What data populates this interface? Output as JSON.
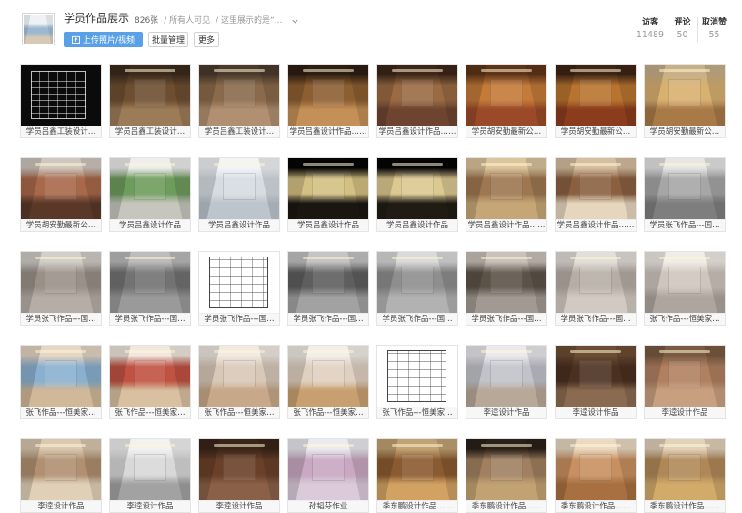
{
  "album": {
    "title": "学员作品展示",
    "count": "826张",
    "visibility": "/ 所有人可见",
    "description": "/ 这里展示的是“…",
    "cover_tones": [
      "#eef2f5",
      "#9cb8d0",
      "#d6cab6"
    ]
  },
  "toolbar": {
    "upload_label": "上传照片/视频",
    "upload_icon": "upload-icon",
    "batch_label": "批量管理",
    "more_label": "更多",
    "expand_icon": "chevron-down-icon"
  },
  "stats": [
    {
      "label": "访客",
      "value": "11489"
    },
    {
      "label": "评论",
      "value": "50"
    },
    {
      "label": "取消赞",
      "value": "55"
    }
  ],
  "colors": {
    "accent": "#5aa0e6",
    "text": "#333333",
    "muted": "#999999"
  },
  "photos": [
    {
      "caption": "学员吕鑫工装设计…",
      "tones": [
        "#0b0b0b",
        "#111111",
        "#0b0b0b"
      ]
    },
    {
      "caption": "学员吕鑫工装设计…",
      "tones": [
        "#3b2a1c",
        "#6e4e30",
        "#9c7b58"
      ]
    },
    {
      "caption": "学员吕鑫工装设计…",
      "tones": [
        "#4a3a2c",
        "#8a6a4a",
        "#b09070"
      ]
    },
    {
      "caption": "学员吕鑫设计作品……",
      "tones": [
        "#2e1e12",
        "#8c5e30",
        "#c49058"
      ]
    },
    {
      "caption": "学员吕鑫设计作品……",
      "tones": [
        "#3c2618",
        "#9a6a42",
        "#6e4430"
      ]
    },
    {
      "caption": "学员胡安勤最新公…",
      "tones": [
        "#5e3418",
        "#c47a38",
        "#9a4a28"
      ]
    },
    {
      "caption": "学员胡安勤最新公…",
      "tones": [
        "#3e2414",
        "#b8742e",
        "#8a3c1c"
      ]
    },
    {
      "caption": "学员胡安勤最新公…",
      "tones": [
        "#c8b088",
        "#d8b070",
        "#a87a48"
      ]
    },
    {
      "caption": "学员胡安勤最新公…",
      "tones": [
        "#cfc6be",
        "#a8684a",
        "#5a3828"
      ]
    },
    {
      "caption": "学员吕鑫设计作品",
      "tones": [
        "#eeeeee",
        "#6e9c5c",
        "#c6c6be"
      ]
    },
    {
      "caption": "学员吕鑫设计作品",
      "tones": [
        "#f2f4f6",
        "#d6dce2",
        "#bcc4cc"
      ]
    },
    {
      "caption": "学员吕鑫设计作品",
      "tones": [
        "#050505",
        "#d4c083",
        "#1a1610"
      ]
    },
    {
      "caption": "学员吕鑫设计作品",
      "tones": [
        "#050505",
        "#dcc891",
        "#201c14"
      ]
    },
    {
      "caption": "学员吕鑫设计作品……",
      "tones": [
        "#dcc49c",
        "#9e7650",
        "#c6a676"
      ]
    },
    {
      "caption": "学员吕鑫设计作品……",
      "tones": [
        "#d6bea0",
        "#8a6040",
        "#e6d6be"
      ]
    },
    {
      "caption": "学员张飞作品---国…",
      "tones": [
        "#e6e6e6",
        "#a6a6a6",
        "#7e7e7e"
      ]
    },
    {
      "caption": "学员张飞作品---国…",
      "tones": [
        "#d2cec8",
        "#9a9088",
        "#b6aea6"
      ]
    },
    {
      "caption": "学员张飞作品---国…",
      "tones": [
        "#bcbcbc",
        "#727272",
        "#9a9a9a"
      ]
    },
    {
      "caption": "学员张飞作品---国…",
      "tones": [
        "#ffffff",
        "#ffffff",
        "#ffffff"
      ]
    },
    {
      "caption": "学员张飞作品---国…",
      "tones": [
        "#c4c4c4",
        "#5e5e5e",
        "#a2a2a2"
      ]
    },
    {
      "caption": "学员张飞作品---国…",
      "tones": [
        "#dadada",
        "#8e8e8e",
        "#b2b2b2"
      ]
    },
    {
      "caption": "学员张飞作品---国…",
      "tones": [
        "#cac2ba",
        "#5c5248",
        "#a29a92"
      ]
    },
    {
      "caption": "学员张飞作品---国…",
      "tones": [
        "#e2ded8",
        "#b6aea6",
        "#d2cac2"
      ]
    },
    {
      "caption": "张飞作品---恒美家…",
      "tones": [
        "#f0ece6",
        "#cec6be",
        "#aea69e"
      ]
    },
    {
      "caption": "张飞作品---恒美家…",
      "tones": [
        "#e6d6c4",
        "#8ab0d0",
        "#d0b898"
      ]
    },
    {
      "caption": "张飞作品---恒美家…",
      "tones": [
        "#f0e8e0",
        "#c05242",
        "#d8c0a0"
      ]
    },
    {
      "caption": "张飞作品---恒美家…",
      "tones": [
        "#f2eae2",
        "#d8c8b8",
        "#c8a888"
      ]
    },
    {
      "caption": "张飞作品---恒美家…",
      "tones": [
        "#f2eee8",
        "#e0d0c0",
        "#c8a070"
      ]
    },
    {
      "caption": "张飞作品---恒美家…",
      "tones": [
        "#ffffff",
        "#ffffff",
        "#ffffff"
      ]
    },
    {
      "caption": "李逵设计作品",
      "tones": [
        "#eaeaee",
        "#c2c2ca",
        "#b8a898"
      ]
    },
    {
      "caption": "李逵设计作品",
      "tones": [
        "#6c4c32",
        "#4a3020",
        "#8a6a50"
      ]
    },
    {
      "caption": "李逵设计作品",
      "tones": [
        "#7a5a40",
        "#b08060",
        "#c8a080"
      ]
    },
    {
      "caption": "李逵设计作品",
      "tones": [
        "#dac8b0",
        "#b09070",
        "#e0d0b8"
      ]
    },
    {
      "caption": "李逵设计作品",
      "tones": [
        "#f2f2f2",
        "#d8d8d8",
        "#a2a2a2"
      ]
    },
    {
      "caption": "李逵设计作品",
      "tones": [
        "#3a2418",
        "#6a4028",
        "#8a6048"
      ]
    },
    {
      "caption": "孙韬芬作业",
      "tones": [
        "#eaeaf0",
        "#c8a8c2",
        "#dacada"
      ]
    },
    {
      "caption": "季东鹏设计作品……",
      "tones": [
        "#c2a272",
        "#8a5a30",
        "#d2a262"
      ]
    },
    {
      "caption": "季东鹏设计作品……",
      "tones": [
        "#2a2018",
        "#a08060",
        "#c2a272"
      ]
    },
    {
      "caption": "季东鹏设计作品……",
      "tones": [
        "#eadac2",
        "#c89060",
        "#a87040"
      ]
    },
    {
      "caption": "季东鹏设计作品……",
      "tones": [
        "#e2d2ba",
        "#b08858",
        "#d2aa6a"
      ]
    }
  ]
}
